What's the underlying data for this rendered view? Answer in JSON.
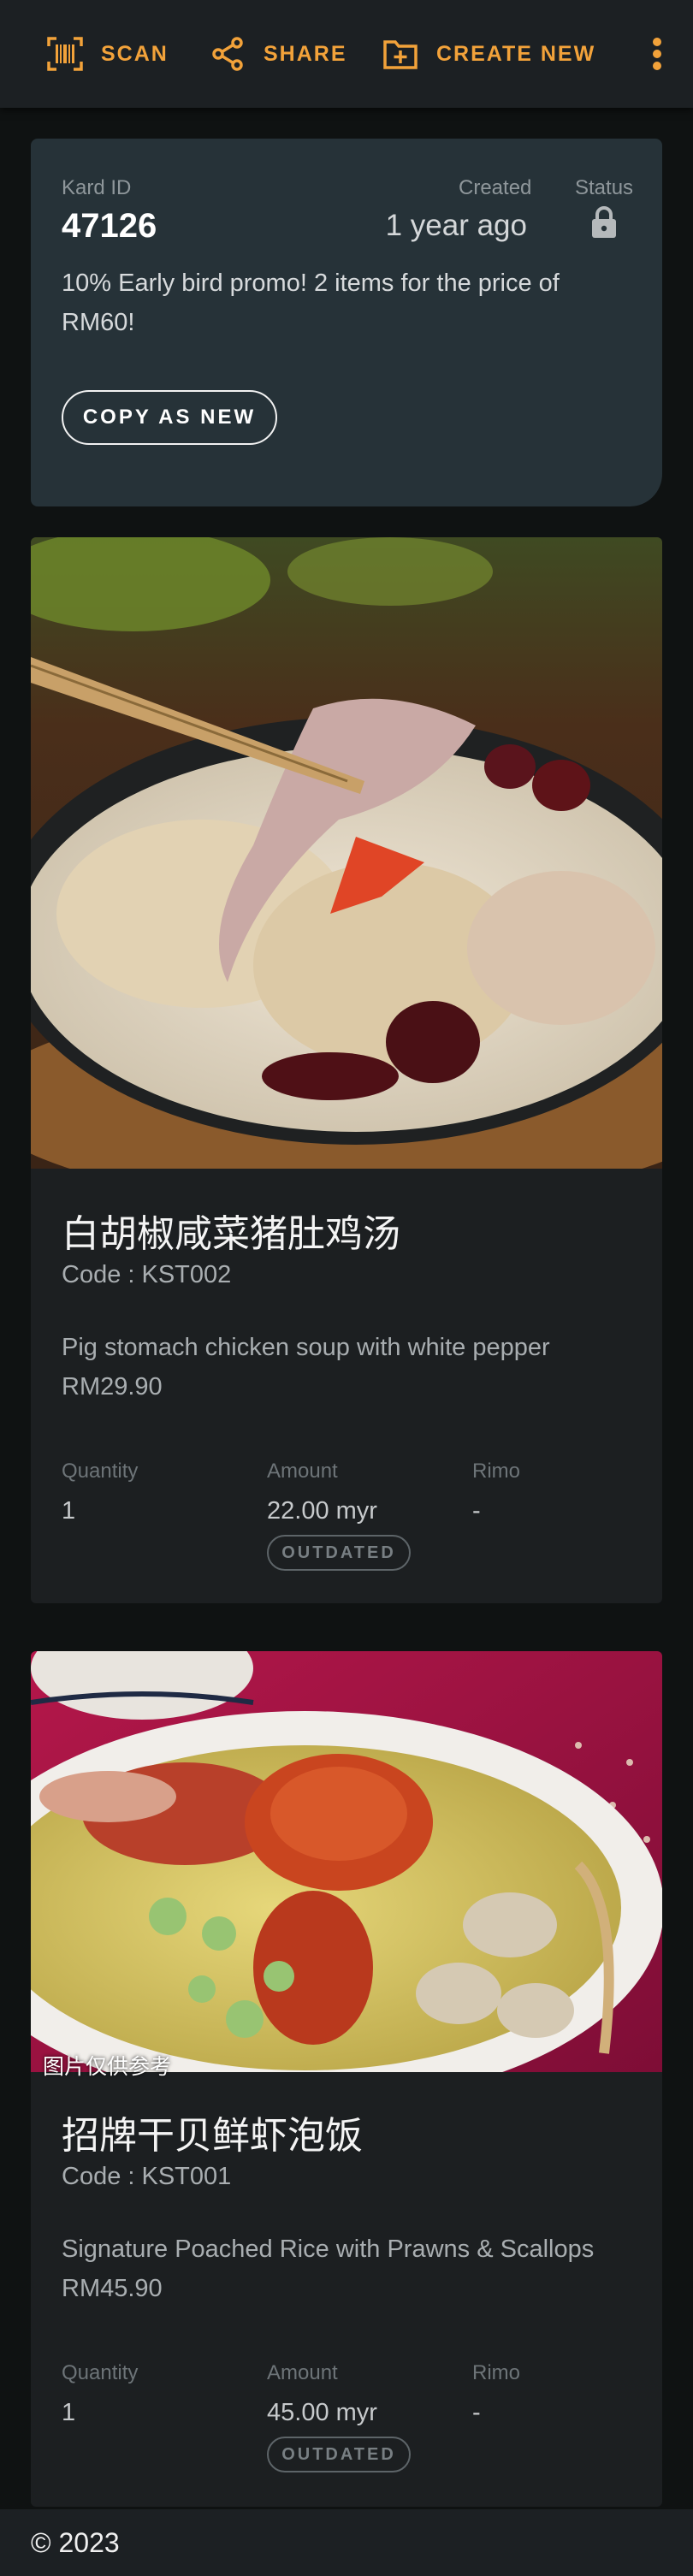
{
  "toolbar": {
    "scan_label": "SCAN",
    "share_label": "SHARE",
    "create_label": "CREATE NEW",
    "icons": [
      "barcode-scan-icon",
      "share-icon",
      "add-box-icon",
      "more-vert-icon"
    ],
    "accent": "#f2a23a"
  },
  "kard": {
    "id_label": "Kard ID",
    "id_value": "47126",
    "created_label": "Created",
    "created_value": "1 year ago",
    "status_label": "Status",
    "status_icon": "lock-icon",
    "promo": "10% Early bird promo! 2 items for the price of RM60!",
    "copy_label": "COPY AS NEW"
  },
  "items": [
    {
      "title": "白胡椒咸菜猪肚鸡汤",
      "code": "Code : KST002",
      "description": "Pig stomach chicken soup with white pepper RM29.90",
      "quantity_label": "Quantity",
      "quantity": "1",
      "amount_label": "Amount",
      "amount": "22.00 myr",
      "rimo_label": "Rimo",
      "rimo": "-",
      "badge": "OUTDATED"
    },
    {
      "title": "招牌干贝鲜虾泡饭",
      "code": "Code : KST001",
      "description": "Signature Poached Rice with Prawns & Scallops RM45.90",
      "quantity_label": "Quantity",
      "quantity": "1",
      "amount_label": "Amount",
      "amount": "45.00 myr",
      "rimo_label": "Rimo",
      "rimo": "-",
      "badge": "OUTDATED",
      "photo_caption": "图片仅供参考"
    }
  ],
  "footer": {
    "copyright": "© 2023"
  }
}
